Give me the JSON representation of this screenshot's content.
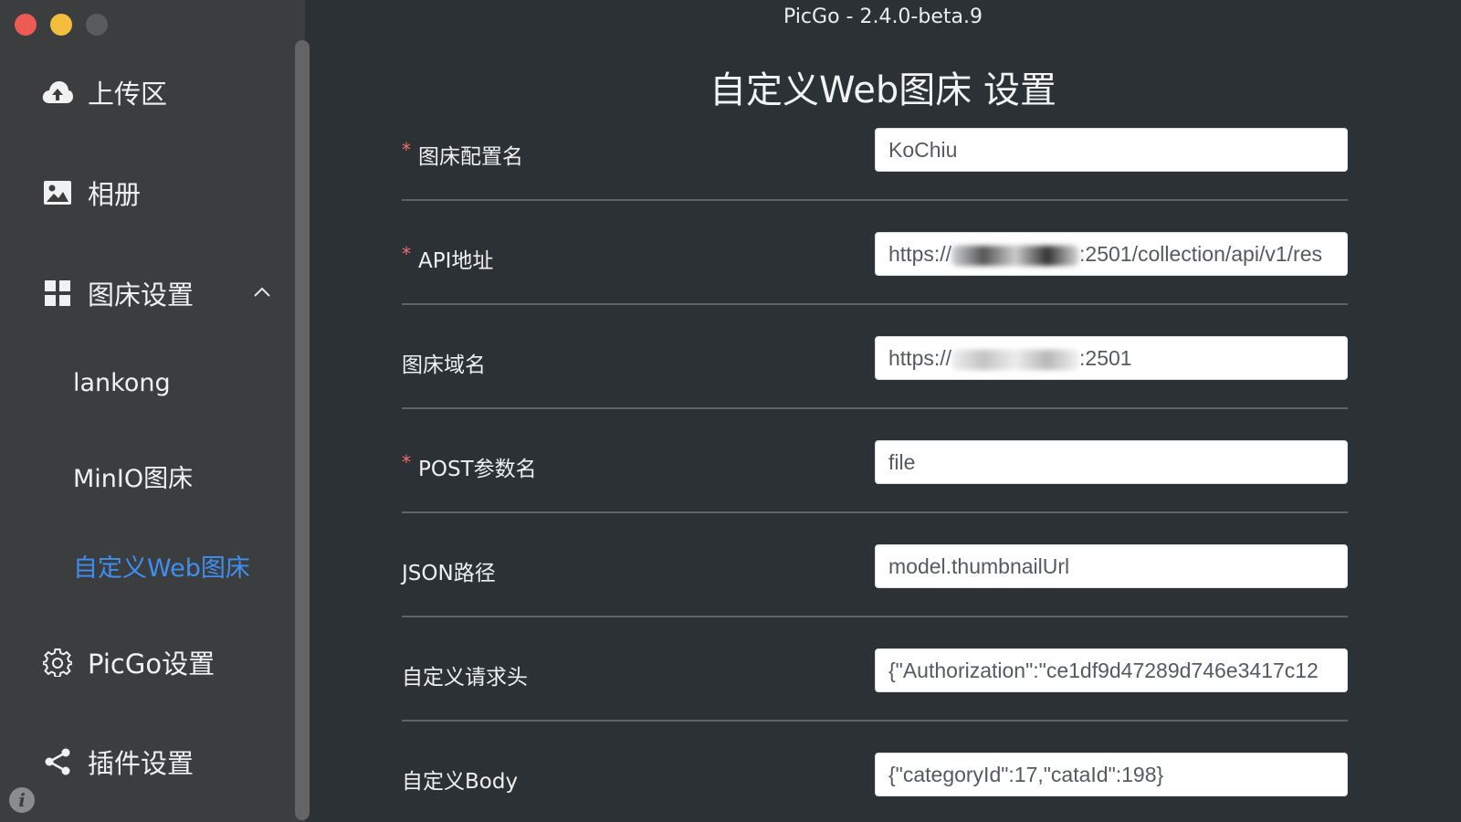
{
  "window": {
    "title": "PicGo - 2.4.0-beta.9"
  },
  "sidebar": {
    "items": [
      {
        "label": "上传区",
        "icon": "cloud-upload-icon"
      },
      {
        "label": "相册",
        "icon": "image-icon"
      },
      {
        "label": "图床设置",
        "icon": "grid-icon",
        "expanded": true,
        "children": [
          {
            "label": "lankong"
          },
          {
            "label": "MinIO图床"
          },
          {
            "label": "自定义Web图床",
            "active": true
          }
        ]
      },
      {
        "label": "PicGo设置",
        "icon": "gear-icon"
      },
      {
        "label": "插件设置",
        "icon": "share-icon"
      }
    ],
    "info_icon": "i",
    "active_color": "#3f8ff0"
  },
  "main": {
    "heading": "自定义Web图床 设置",
    "fields": [
      {
        "label": "图床配置名",
        "required": true,
        "value": "KoChiu"
      },
      {
        "label": "API地址",
        "required": true,
        "value_prefix": "https://",
        "value_suffix": ":2501/collection/api/v1/res"
      },
      {
        "label": "图床域名",
        "required": false,
        "value_prefix": "https://",
        "value_suffix": ":2501"
      },
      {
        "label": "POST参数名",
        "required": true,
        "value": "file"
      },
      {
        "label": "JSON路径",
        "required": false,
        "value": "model.thumbnailUrl"
      },
      {
        "label": "自定义请求头",
        "required": false,
        "value": "{\"Authorization\":\"ce1df9d47289d746e3417c12"
      },
      {
        "label": "自定义Body",
        "required": false,
        "value": "{\"categoryId\":17,\"cataId\":198}"
      }
    ]
  }
}
